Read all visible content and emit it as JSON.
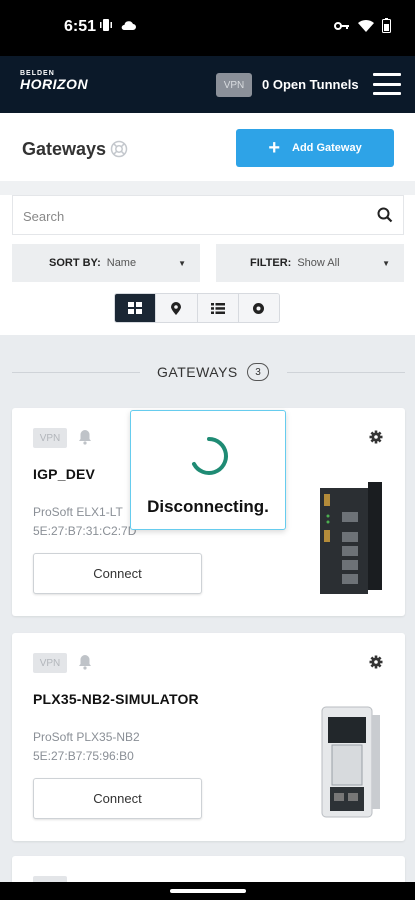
{
  "status_bar": {
    "time": "6:51"
  },
  "header": {
    "logo_top": "BELDEN",
    "logo_main": "HORIZON",
    "vpn_badge": "VPN",
    "tunnels_text": "0 Open Tunnels"
  },
  "page": {
    "title": "Gateways",
    "add_gateway_label": "Add Gateway",
    "search_placeholder": "Search",
    "sort_label": "SORT BY:",
    "sort_value": "Name",
    "filter_label": "FILTER:",
    "filter_value": "Show All"
  },
  "section": {
    "title": "GATEWAYS",
    "count": "3"
  },
  "gateways": [
    {
      "vpn": "VPN",
      "name": "IGP_DEV",
      "model": "ProSoft ELX1-LT",
      "mac": "5E:27:B7:31:C2:7D",
      "connect_label": "Connect"
    },
    {
      "vpn": "VPN",
      "name": "PLX35-NB2-SIMULATOR",
      "model": "ProSoft PLX35-NB2",
      "mac": "5E:27:B7:75:96:B0",
      "connect_label": "Connect"
    },
    {
      "vpn": "VPN"
    }
  ],
  "overlay": {
    "message": "Disconnecting."
  },
  "colors": {
    "header_bg": "#0b1929",
    "accent": "#2ea3e7",
    "spinner": "#1f8b74"
  }
}
